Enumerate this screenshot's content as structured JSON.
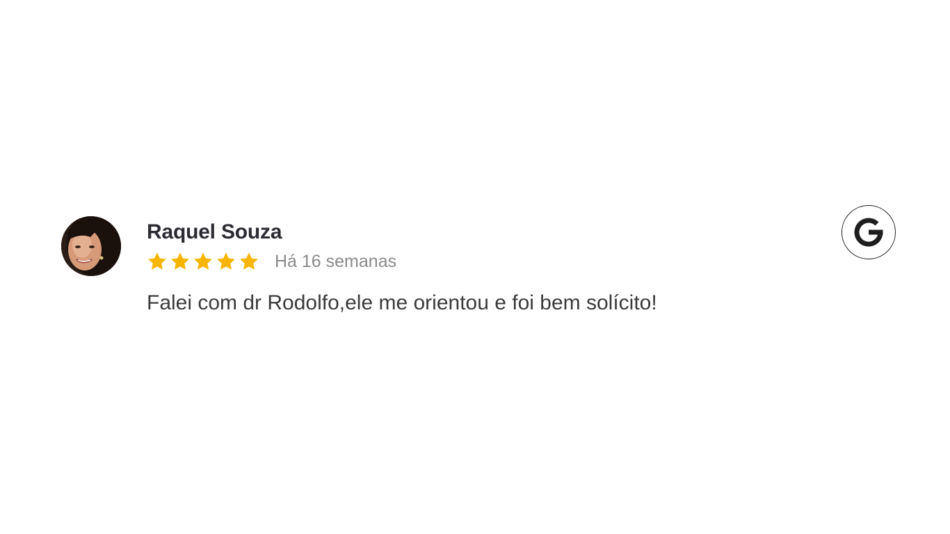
{
  "review": {
    "author": "Raquel Souza",
    "rating": 5,
    "rating_max": 5,
    "date": "Há 16 semanas",
    "text": "Falei com dr Rodolfo,ele me orientou e foi bem solícito!"
  },
  "icons": {
    "avatar": "avatar",
    "star": "star-icon",
    "source": "google-icon"
  },
  "colors": {
    "star": "#f7b500",
    "name": "#2b2b33",
    "date": "#8a8a8a",
    "text": "#3a3a3a"
  }
}
